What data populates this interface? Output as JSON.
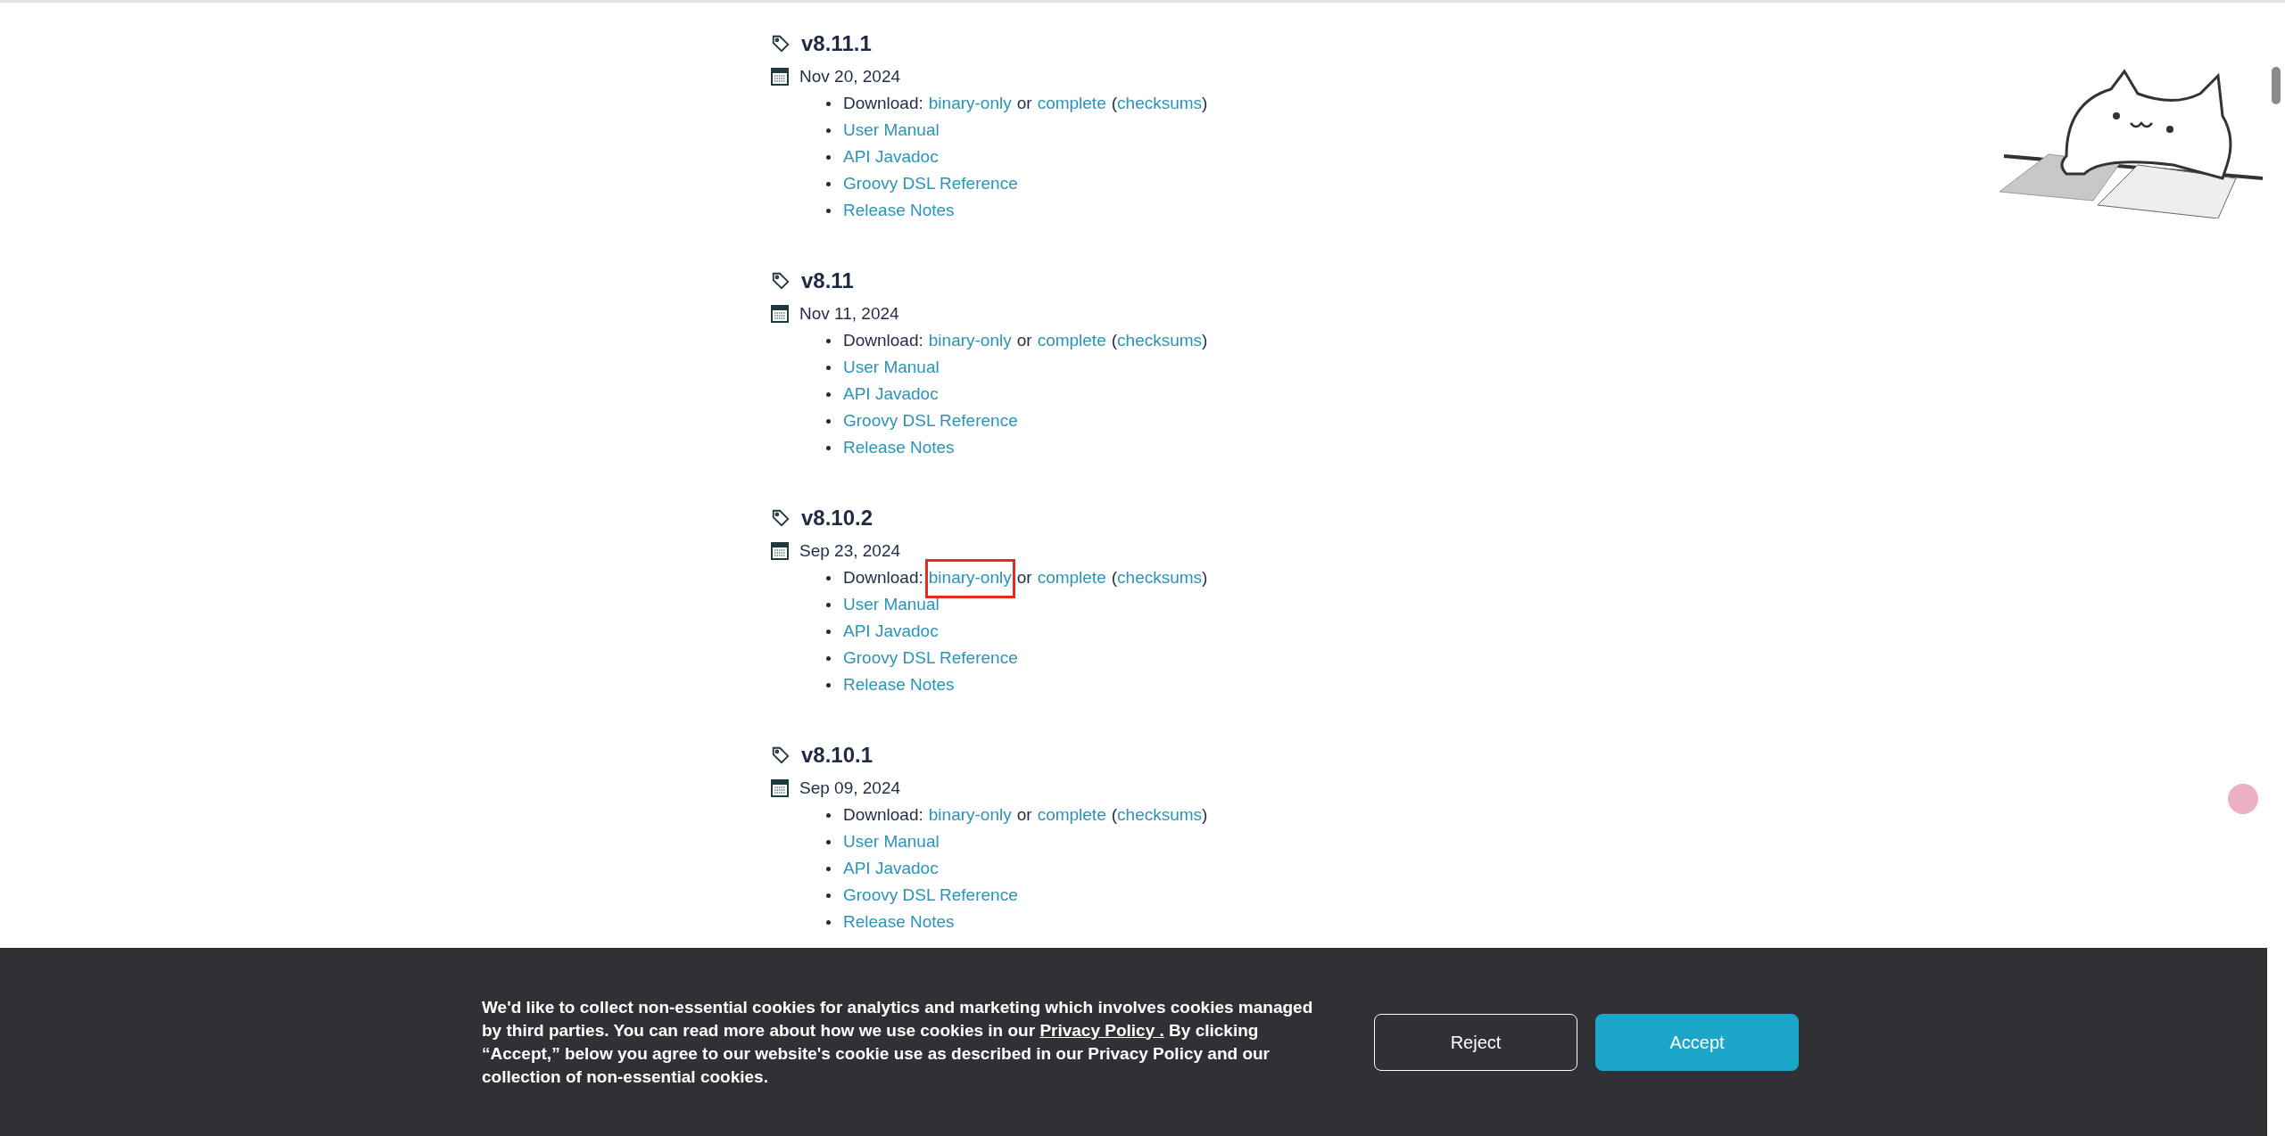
{
  "releases": [
    {
      "version": "v8.11.1",
      "date": "Nov 20, 2024",
      "download": {
        "label": "Download:",
        "binary": "binary-only",
        "binary_highlighted": false,
        "or": "or",
        "complete": "complete",
        "open": "(",
        "checksums": "checksums",
        "close": ")"
      },
      "links": [
        "User Manual",
        "API Javadoc",
        "Groovy DSL Reference",
        "Release Notes"
      ]
    },
    {
      "version": "v8.11",
      "date": "Nov 11, 2024",
      "download": {
        "label": "Download:",
        "binary": "binary-only",
        "binary_highlighted": false,
        "or": "or",
        "complete": "complete",
        "open": "(",
        "checksums": "checksums",
        "close": ")"
      },
      "links": [
        "User Manual",
        "API Javadoc",
        "Groovy DSL Reference",
        "Release Notes"
      ]
    },
    {
      "version": "v8.10.2",
      "date": "Sep 23, 2024",
      "download": {
        "label": "Download:",
        "binary": "binary-only",
        "binary_highlighted": true,
        "or": "or",
        "complete": "complete",
        "open": "(",
        "checksums": "checksums",
        "close": ")"
      },
      "links": [
        "User Manual",
        "API Javadoc",
        "Groovy DSL Reference",
        "Release Notes"
      ]
    },
    {
      "version": "v8.10.1",
      "date": "Sep 09, 2024",
      "download": {
        "label": "Download:",
        "binary": "binary-only",
        "binary_highlighted": false,
        "or": "or",
        "complete": "complete",
        "open": "(",
        "checksums": "checksums",
        "close": ")"
      },
      "links": [
        "User Manual",
        "API Javadoc",
        "Groovy DSL Reference",
        "Release Notes"
      ]
    }
  ],
  "cookie_banner": {
    "text_before": "We'd like to collect non-essential cookies for analytics and marketing which involves cookies managed by third parties. You can read more about how we use cookies in our",
    "link": "Privacy Policy .",
    "text_after": "By clicking “Accept,” below you agree to our website's cookie use as described in our Privacy Policy and our collection of non-essential cookies.",
    "buttons": [
      {
        "label": "Reject",
        "kind": "outline"
      },
      {
        "label": "Accept",
        "kind": "primary"
      }
    ]
  }
}
